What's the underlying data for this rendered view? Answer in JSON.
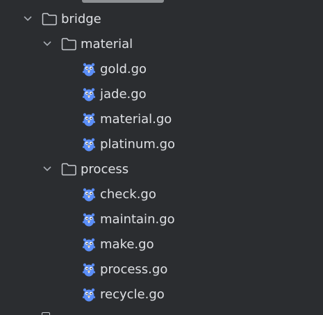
{
  "project_tree": {
    "partial_top_item": {
      "icon": "go-file-icon",
      "label": ""
    },
    "folders": [
      {
        "label": "bridge",
        "icon": "folder-icon",
        "expanded": true,
        "children": [
          {
            "label": "material",
            "icon": "folder-icon",
            "expanded": true,
            "files": [
              "gold.go",
              "jade.go",
              "material.go",
              "platinum.go"
            ]
          },
          {
            "label": "process",
            "icon": "folder-icon",
            "expanded": true,
            "files": [
              "check.go",
              "maintain.go",
              "make.go",
              "process.go",
              "recycle.go"
            ]
          }
        ]
      }
    ],
    "partial_bottom_item": {
      "icon": "folder-icon",
      "label": ""
    }
  },
  "colors": {
    "background": "#2b2d30",
    "text": "#dfe1e5",
    "chevron": "#a8acb3",
    "folder_outline": "#c9ccd1",
    "gopher_body": "#5b8ef7"
  }
}
